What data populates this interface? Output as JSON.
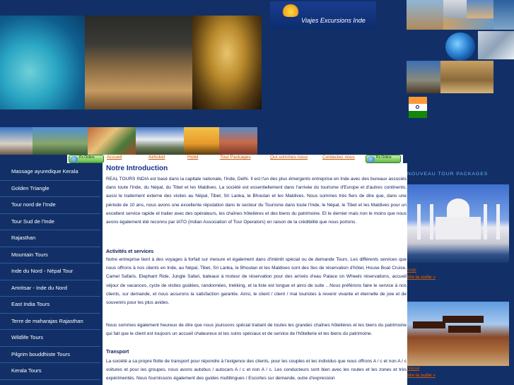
{
  "header": {
    "logo_text": "Viajes Excursions Inde",
    "logo_image_desc": "logo"
  },
  "nav": {
    "online_buttons": [
      "Ps Online",
      "Ps Online"
    ],
    "links": [
      "Accueil",
      "Airticket",
      "Hotel",
      "Tour Packages",
      "Qui sommes nous",
      "Contactez nous"
    ]
  },
  "sidebar": {
    "items": [
      {
        "label": "Massage ayuredique Kerala"
      },
      {
        "label": "Golden Triangle"
      },
      {
        "label": "Tour nord de l'Inde"
      },
      {
        "label": "Tour Sud de l'Inde"
      },
      {
        "label": "Rajasthan"
      },
      {
        "label": "Mountain Tours"
      },
      {
        "label": "Inde du Nord - Népal Tour"
      },
      {
        "label": "Amritsar - Inde du Nord"
      },
      {
        "label": "East India Tours"
      },
      {
        "label": "Terre de maharajas Rajasthan"
      },
      {
        "label": "Wildlife Tours"
      },
      {
        "label": "Pilgrim bouddhiste Tours"
      },
      {
        "label": "Kerala Tours"
      }
    ]
  },
  "main": {
    "title": "Notre Introduction",
    "intro_p1": "REAL TOURS INDIA est basé dans la capitale nationale, l'Inde, Delhi. Il est l'un des plus émergents entreprise en Inde avec des bureaux associés dans toute l'Inde, du Népal, du Tibet et les Maldives. La société est essentiellement dans l'arrivée du tourisme d'Europe et d'autres continents, aussi le traitement externe des visites au Népal, Tibet, Sri Lanka, le Bhoutan et les Maldives. Nous sommes très fiers de dire que, dans une période de 10 ans, nous avons une excellente réputation dans le secteur du Tourisme dans toute l'Inde, le Népal, le Tibet et les Maldives pour un excellent service rapide et traiter avec des opérateurs, les chaînes hôtelières et des biens du patrimoine. Et le dernier mais non le moins que nous avons également été reconnu par IATO (Indian Association of Tour Operators) en raison de la crédibilité que nous portons.",
    "section1_title": "Activités et services",
    "section1_text": "Notre entreprise tient à des voyages à forfait sur mesure et également dans d'intérêt spécial ou de demande Tours. Les différents services que nous offrons à nos clients en Inde, au Népal, Tibet, Sri Lanka, le Bhoutan et les Maldives sont des îles de réservation d'hôtel, House Boat Cruise, Camel Safaris, Elephant Ride, Jungle Safari, bateaux à moteur de réservation pour des arrivés d'eau Palace on Wheels réservations, accueil séjour de vacances, cycle de visites guidées, randonnées, trekking, et la liste est longue et ainsi de suite ...Nous préférons faire le service à nos clients, sur demande, et nous assurons la satisfaction garantie. Ainsi, le client / client / mai touristes à revenir vivante et éternelle de joie et de souvenirs pour les plus avides.",
    "section2_text": "Nous sommes également heureux de dire que nous jouissons spécial traitant de toutes les grandes chaînes hôtelières et les biens du patrimoine qui fait que le client est toujours un accueil chaleureux et les soins spéciaux et de service de l'hôtellerie et les biens du patrimoine.",
    "section3_title": "Transport",
    "section3_text": "La société a sa propre flotte de transport pour répondre à l'exigence des clients, pour les couples et les individus que nous offrons A / c et non A / c voitures et pour les groupes, nous avons autobus / autocars A / c et non A / c. Les conducteurs sont bien avec les routes et les zones et très expérimentés. Nous fournissons également des guides multilingues / Escortes sur demande, outre d'expression"
  },
  "right": {
    "title": "NOUVEAU TOUR PACKAGES",
    "packages": [
      {
        "name": "Inde",
        "more": "lire la suite »"
      },
      {
        "name": "Nepal",
        "more": "lire la suite »"
      }
    ]
  },
  "colors": {
    "background": "#123067",
    "link_orange": "#cc5500",
    "heading_blue": "#11308a",
    "right_title": "#6db4ff"
  }
}
